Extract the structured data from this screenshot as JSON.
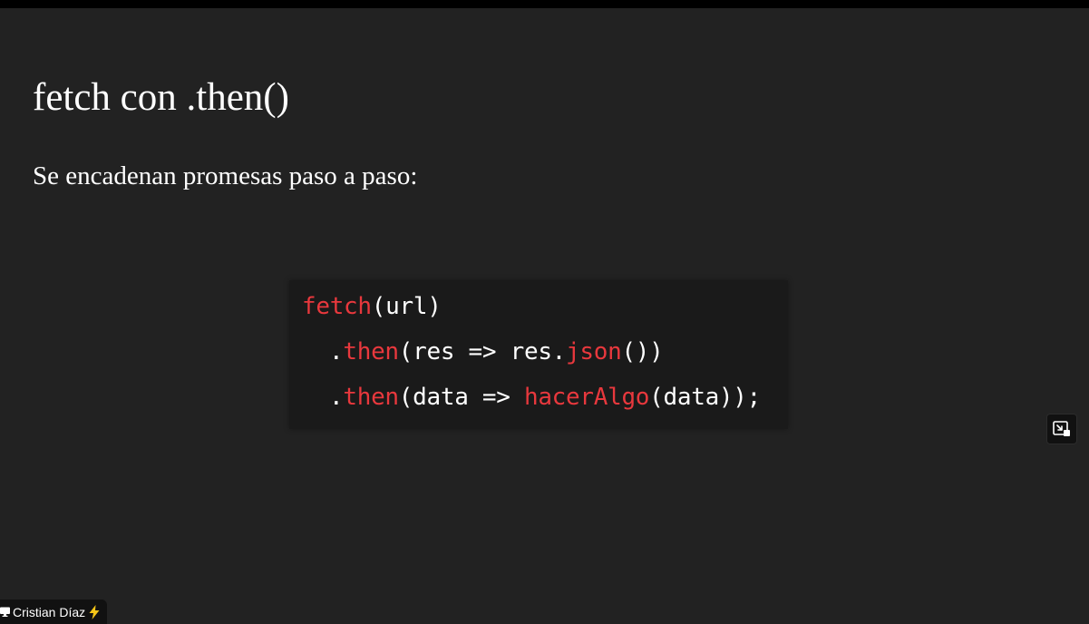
{
  "slide": {
    "title": "fetch con .then()",
    "subtitle": "Se encadenan promesas paso a paso:"
  },
  "code": {
    "line1": {
      "t1": "fetch",
      "t2": "(url)"
    },
    "line2": {
      "t1": ".",
      "t2": "then",
      "t3": "(res => res.",
      "t4": "json",
      "t5": "())"
    },
    "line3": {
      "t1": ".",
      "t2": "then",
      "t3": "(data => ",
      "t4": "hacerAlgo",
      "t5": "(data));"
    }
  },
  "presenter": {
    "name": "Cristian Díaz",
    "icon": "screen-share-icon",
    "badge_icon": "lightning-bolt-icon"
  },
  "controls": {
    "pip_icon": "picture-in-picture-icon"
  },
  "colors": {
    "background": "#222222",
    "code_background": "#1a1a1a",
    "keyword_red": "#e8383d",
    "text": "#ffffff",
    "bolt": "#f5c518"
  }
}
